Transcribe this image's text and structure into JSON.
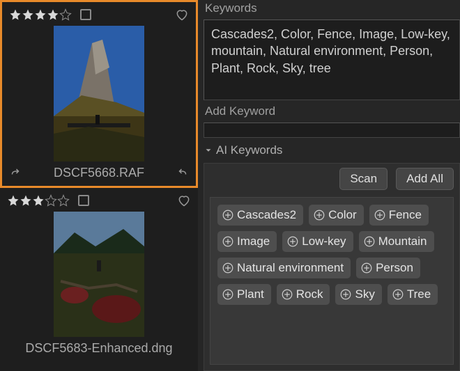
{
  "thumbs": [
    {
      "filename": "DSCF5668.RAF",
      "rating": 4,
      "selected": true
    },
    {
      "filename": "DSCF5683-Enhanced.dng",
      "rating": 3,
      "selected": false
    }
  ],
  "panel": {
    "keywords_label": "Keywords",
    "keywords_text": "Cascades2, Color, Fence, Image, Low-key, mountain, Natural environment, Person, Plant, Rock, Sky, tree",
    "add_keyword_label": "Add Keyword",
    "ai_section_label": "AI Keywords",
    "scan_label": "Scan",
    "add_all_label": "Add All",
    "ai_tags": [
      "Cascades2",
      "Color",
      "Fence",
      "Image",
      "Low-key",
      "Mountain",
      "Natural environment",
      "Person",
      "Plant",
      "Rock",
      "Sky",
      "Tree"
    ]
  },
  "colors": {
    "selection": "#e88a2a",
    "star_filled": "#d8d8d8",
    "star_empty": "#5a5a5a"
  }
}
